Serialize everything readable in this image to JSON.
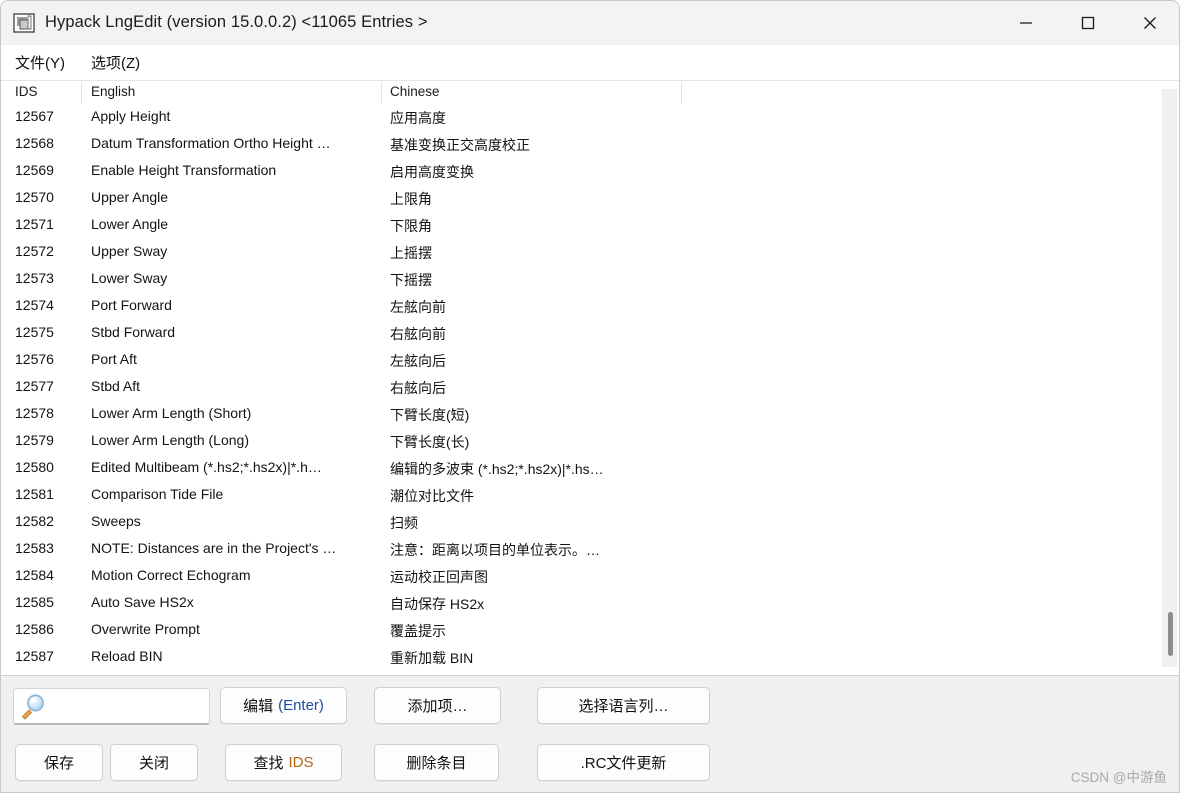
{
  "window": {
    "title": "Hypack LngEdit (version 15.0.0.2)  <11065 Entries >",
    "icon": "app-window-icon",
    "controls": {
      "minimize": "minimize-icon",
      "maximize": "maximize-icon",
      "close": "close-icon"
    }
  },
  "menu": {
    "items": [
      {
        "label": "文件(Y)"
      },
      {
        "label": "选项(Z)"
      }
    ]
  },
  "list": {
    "columns": [
      {
        "label": "IDS"
      },
      {
        "label": "English"
      },
      {
        "label": "Chinese"
      }
    ],
    "rows": [
      {
        "ids": "12567",
        "english": "Apply Height",
        "chinese": "应用高度"
      },
      {
        "ids": "12568",
        "english": "Datum Transformation Ortho Height …",
        "chinese": "基准变换正交高度校正"
      },
      {
        "ids": "12569",
        "english": "Enable Height Transformation",
        "chinese": "启用高度变换"
      },
      {
        "ids": "12570",
        "english": "Upper Angle",
        "chinese": "上限角"
      },
      {
        "ids": "12571",
        "english": "Lower Angle",
        "chinese": "下限角"
      },
      {
        "ids": "12572",
        "english": "Upper Sway",
        "chinese": "上摇摆"
      },
      {
        "ids": "12573",
        "english": "Lower Sway",
        "chinese": "下摇摆"
      },
      {
        "ids": "12574",
        "english": "Port Forward",
        "chinese": "左舷向前"
      },
      {
        "ids": "12575",
        "english": "Stbd Forward",
        "chinese": "右舷向前"
      },
      {
        "ids": "12576",
        "english": "Port Aft",
        "chinese": "左舷向后"
      },
      {
        "ids": "12577",
        "english": "Stbd Aft",
        "chinese": "右舷向后"
      },
      {
        "ids": "12578",
        "english": "Lower Arm Length (Short)",
        "chinese": "下臂长度(短)"
      },
      {
        "ids": "12579",
        "english": "Lower Arm Length (Long)",
        "chinese": "下臂长度(长)"
      },
      {
        "ids": "12580",
        "english": "Edited Multibeam (*.hs2;*.hs2x)|*.h…",
        "chinese": "编辑的多波束 (*.hs2;*.hs2x)|*.hs…"
      },
      {
        "ids": "12581",
        "english": "Comparison Tide File",
        "chinese": "潮位对比文件"
      },
      {
        "ids": "12582",
        "english": "Sweeps",
        "chinese": "扫频"
      },
      {
        "ids": "12583",
        "english": "NOTE: Distances are in the Project's …",
        "chinese": "注意：距离以项目的单位表示。…"
      },
      {
        "ids": "12584",
        "english": "Motion Correct Echogram",
        "chinese": "运动校正回声图"
      },
      {
        "ids": "12585",
        "english": "Auto Save HS2x",
        "chinese": "自动保存 HS2x"
      },
      {
        "ids": "12586",
        "english": "Overwrite Prompt",
        "chinese": "覆盖提示"
      },
      {
        "ids": "12587",
        "english": "Reload BIN",
        "chinese": "重新加载 BIN"
      }
    ]
  },
  "scrollbar": {
    "orientation": "vertical"
  },
  "bottom": {
    "search": {
      "value": "",
      "placeholder": "",
      "icon": "magnifier-icon"
    },
    "buttons": [
      {
        "label": "编辑",
        "accent": "(Enter)"
      },
      {
        "label": "添加项…"
      },
      {
        "label": "选择语言列…"
      },
      {
        "label": "保存"
      },
      {
        "label": "关闭"
      },
      {
        "label": "查找",
        "accent": "IDS"
      },
      {
        "label": "删除条目"
      },
      {
        "label": ".RC文件更新"
      }
    ]
  },
  "watermark": {
    "text": "CSDN @中游鱼"
  },
  "colors": {
    "titlebar_bg": "#f3f3f3",
    "panel_bg": "#f0f0f0",
    "accent_blue": "#1c4da1",
    "accent_amber": "#b06a14",
    "text": "#131313"
  }
}
